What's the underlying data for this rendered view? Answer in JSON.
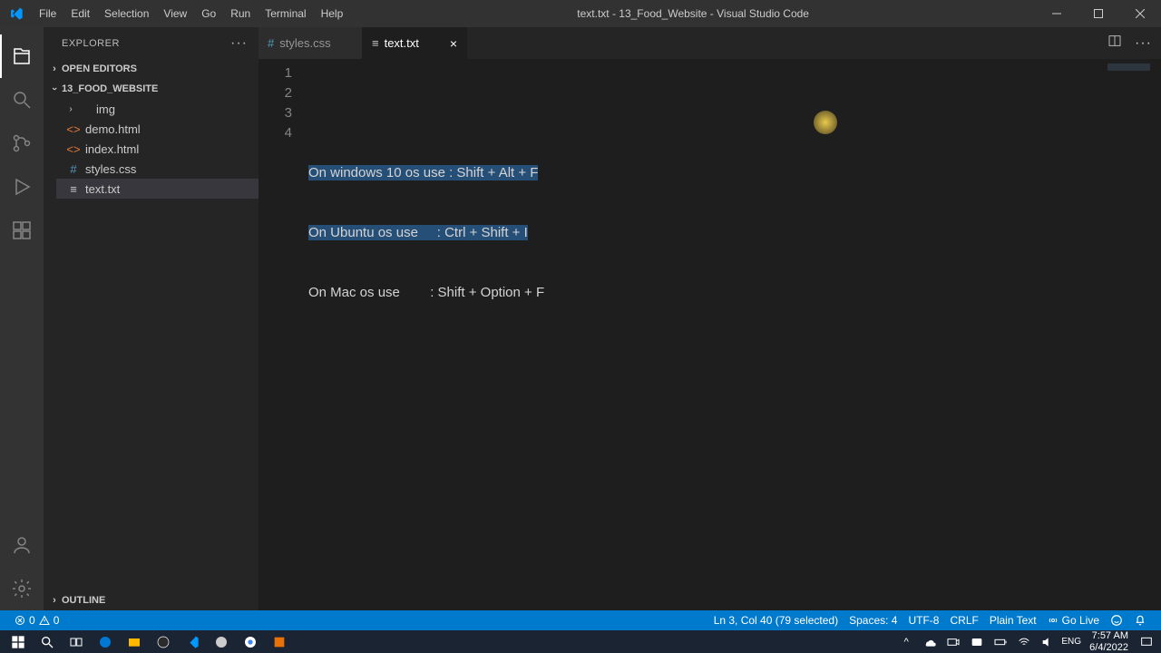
{
  "titlebar": {
    "menus": [
      "File",
      "Edit",
      "Selection",
      "View",
      "Go",
      "Run",
      "Terminal",
      "Help"
    ],
    "title": "text.txt - 13_Food_Website - Visual Studio Code"
  },
  "sidebar": {
    "header": "EXPLORER",
    "open_editors": "OPEN EDITORS",
    "project": "13_FOOD_WEBSITE",
    "outline": "OUTLINE",
    "tree": [
      {
        "name": "img",
        "type": "folder"
      },
      {
        "name": "demo.html",
        "type": "html"
      },
      {
        "name": "index.html",
        "type": "html"
      },
      {
        "name": "styles.css",
        "type": "css"
      },
      {
        "name": "text.txt",
        "type": "txt",
        "selected": true
      }
    ]
  },
  "tabs": [
    {
      "label": "styles.css",
      "type": "css",
      "active": false
    },
    {
      "label": "text.txt",
      "type": "txt",
      "active": true
    }
  ],
  "editor": {
    "lines": [
      "",
      "On windows 10 os use : Shift + Alt + F",
      "On Ubuntu os use     : Ctrl + Shift + I",
      "On Mac os use        : Shift + Option + F"
    ],
    "selected_line_indices": [
      1,
      2
    ]
  },
  "statusbar": {
    "errors": "0",
    "warnings": "0",
    "cursor": "Ln 3, Col 40 (79 selected)",
    "spaces": "Spaces: 4",
    "encoding": "UTF-8",
    "eol": "CRLF",
    "lang": "Plain Text",
    "golive": "Go Live"
  },
  "taskbar": {
    "time": "7:57 AM",
    "date": "6/4/2022"
  }
}
